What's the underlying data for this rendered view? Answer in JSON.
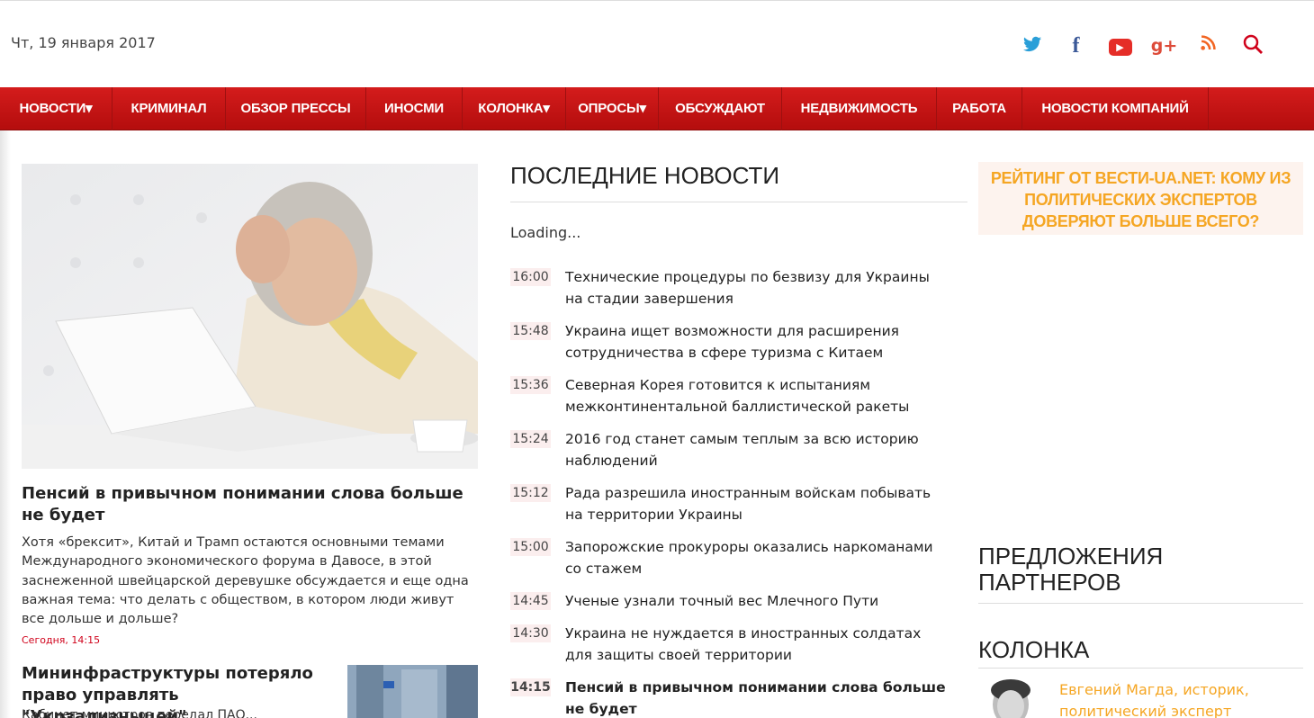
{
  "header": {
    "date": "Чт, 19 января 2017",
    "social": [
      {
        "icon": "twitter-icon",
        "glyph": "🐦"
      },
      {
        "icon": "facebook-icon",
        "glyph": "f"
      },
      {
        "icon": "youtube-icon",
        "glyph": "▶"
      },
      {
        "icon": "google-plus-icon",
        "glyph": "g+"
      },
      {
        "icon": "rss-icon",
        "glyph": "))"
      },
      {
        "icon": "search-icon",
        "glyph": "⚲"
      }
    ]
  },
  "nav": {
    "items": [
      {
        "label": "НОВОСТИ▾"
      },
      {
        "label": "КРИМИНАЛ"
      },
      {
        "label": "ОБЗОР ПРЕССЫ"
      },
      {
        "label": "ИНОСМИ"
      },
      {
        "label": "КОЛОНКА▾"
      },
      {
        "label": "ОПРОСЫ▾"
      },
      {
        "label": "ОБСУЖДАЮТ"
      },
      {
        "label": "НЕДВИЖИМОСТЬ"
      },
      {
        "label": "РАБОТА"
      },
      {
        "label": "НОВОСТИ КОМПАНИЙ"
      }
    ]
  },
  "hero": {
    "title": "Пенсий в привычном понимании слова больше не будет",
    "text": "Хотя «брексит», Китай и Трамп остаются основными темами Международного экономического форума в Давосе, в этой заснеженной швейцарской деревушке обсуждается и еще одна важная тема: что делать с обществом, в котором люди живут все дольше и дольше?",
    "time": "Сегодня, 14:15"
  },
  "second": {
    "title": "Мининфраструктуры потеряло право управлять \"Укрзализныцей\"",
    "text": "Кабинет министров передал ПАО..."
  },
  "latest": {
    "heading": "ПОСЛЕДНИЕ НОВОСТИ",
    "loading": "Loading...",
    "items": [
      {
        "time": "16:00",
        "title": "Технические процедуры по безвизу для Украины на стадии завершения"
      },
      {
        "time": "15:48",
        "title": "Украина ищет возможности для расширения сотрудничества в сфере туризма с Китаем"
      },
      {
        "time": "15:36",
        "title": "Северная Корея готовится к испытаниям межконтинентальной баллистической ракеты"
      },
      {
        "time": "15:24",
        "title": "2016 год станет самым теплым за всю историю наблюдений"
      },
      {
        "time": "15:12",
        "title": "Рада разрешила иностранным войскам побывать на территории Украины"
      },
      {
        "time": "15:00",
        "title": "Запорожские прокуроры оказались наркоманами со стажем"
      },
      {
        "time": "14:45",
        "title": "Ученые узнали точный вес Млечного Пути"
      },
      {
        "time": "14:30",
        "title": "Украина не нуждается в иностранных солдатах для защиты своей территории"
      },
      {
        "time": "14:15",
        "title": "Пенсий в привычном понимании слова больше не будет"
      }
    ]
  },
  "sidebar": {
    "promo": "РЕЙТИНГ ОТ ВЕСТИ-UA.NET: КОМУ ИЗ ПОЛИТИЧЕСКИХ ЭКСПЕРТОВ ДОВЕРЯЮТ БОЛЬШЕ ВСЕГО?",
    "partners": "ПРЕДЛОЖЕНИЯ ПАРТНЕРОВ",
    "kolonka": "КОЛОНКА",
    "author": "Евгений Магда, историк, политический эксперт"
  },
  "colors": {
    "brand_red": "#c8161b",
    "accent_orange": "#f5a623",
    "time_bg": "#fbeeee"
  }
}
